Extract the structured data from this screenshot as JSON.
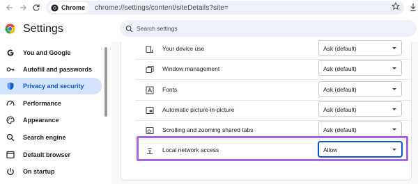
{
  "browser": {
    "chip_label": "Chrome",
    "url": "chrome://settings/content/siteDetails?site=",
    "icons": [
      "back-arrow-icon",
      "forward-arrow-icon",
      "bookmark-star-icon",
      "download-icon"
    ]
  },
  "header": {
    "title": "Settings",
    "search_placeholder": "Search settings"
  },
  "sidebar": {
    "items": [
      {
        "label": "You and Google",
        "icon": "google-g-icon",
        "active": false
      },
      {
        "label": "Autofill and passwords",
        "icon": "key-icon",
        "active": false
      },
      {
        "label": "Privacy and security",
        "icon": "shield-icon",
        "active": true
      },
      {
        "label": "Performance",
        "icon": "speedometer-icon",
        "active": false
      },
      {
        "label": "Appearance",
        "icon": "palette-icon",
        "active": false
      },
      {
        "label": "Search engine",
        "icon": "search-icon",
        "active": false
      },
      {
        "label": "Default browser",
        "icon": "browser-window-icon",
        "active": false
      },
      {
        "label": "On startup",
        "icon": "power-icon",
        "active": false
      }
    ]
  },
  "permissions": [
    {
      "label": "Your device use",
      "icon": "device-use-icon",
      "value": "Ask (default)"
    },
    {
      "label": "Window management",
      "icon": "window-management-icon",
      "value": "Ask (default)"
    },
    {
      "label": "Fonts",
      "icon": "font-icon",
      "value": "Ask (default)"
    },
    {
      "label": "Automatic picture-in-picture",
      "icon": "picture-in-picture-icon",
      "value": "Ask (default)"
    },
    {
      "label": "Scrolling and zooming shared tabs",
      "icon": "shared-tab-icon",
      "value": "Ask (default)"
    },
    {
      "label": "Local network access",
      "icon": "local-network-icon",
      "value": "Allow"
    }
  ],
  "colors": {
    "accent": "#0b57d0",
    "active_nav_bg": "#d3e3fd",
    "highlight_border": "#a666e8"
  }
}
